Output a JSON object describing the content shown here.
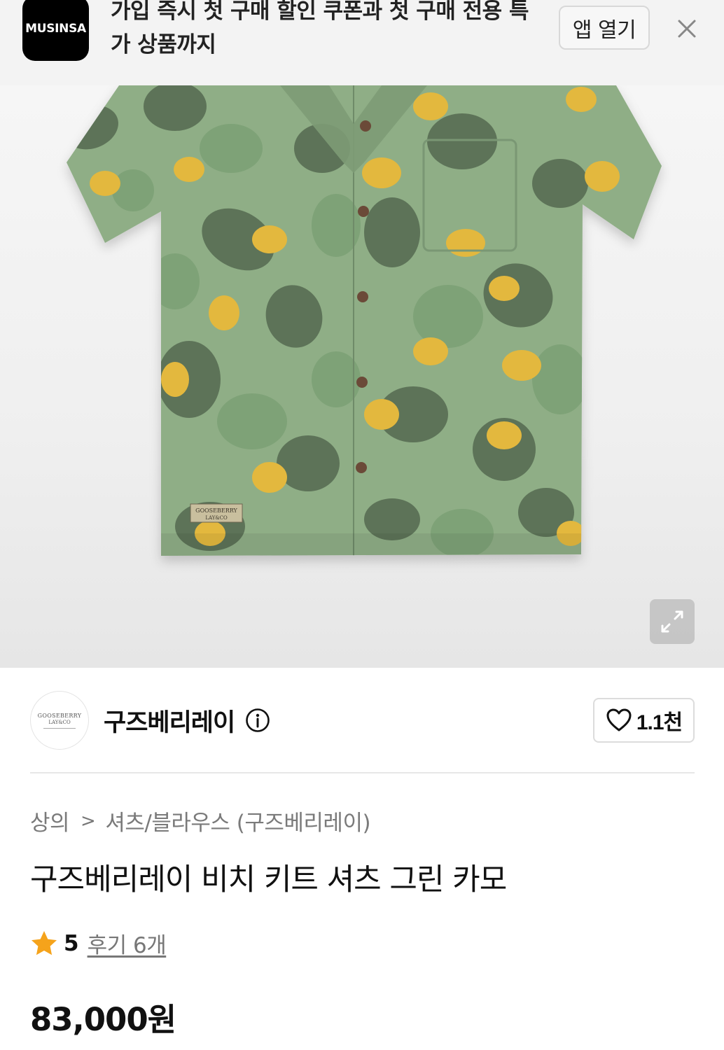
{
  "app_banner": {
    "logo_text": "MUSINSA",
    "message": "가입 즉시 첫 구매 할인 쿠폰과 첫 구매 전용 특가 상품까지",
    "open_label": "앱 열기",
    "close_icon": "close-icon"
  },
  "product_image": {
    "shirt_label_line1": "GOOSEBERRY",
    "shirt_label_line2": "LAY&CO",
    "expand_icon": "expand-icon"
  },
  "brand": {
    "logo_line1": "GOOSEBERRY",
    "logo_line2": "LAY&CO",
    "name": "구즈베리레이",
    "info_icon": "info-icon",
    "like_icon": "heart-icon",
    "like_count": "1.1천"
  },
  "breadcrumb": {
    "category": "상의",
    "separator": ">",
    "subcategory": "셔츠/블라우스 (구즈베리레이)"
  },
  "product": {
    "title": "구즈베리레이 비치 키트 셔츠 그린 카모",
    "rating": "5",
    "review_text": "후기 6개",
    "price": "83,000원"
  },
  "colors": {
    "star": "#f5a31b",
    "shirt_base": "#8fae86",
    "leaf_dark": "#5d7358",
    "leaf_mid": "#7ea277",
    "leaf_yellow": "#e3b83e"
  }
}
